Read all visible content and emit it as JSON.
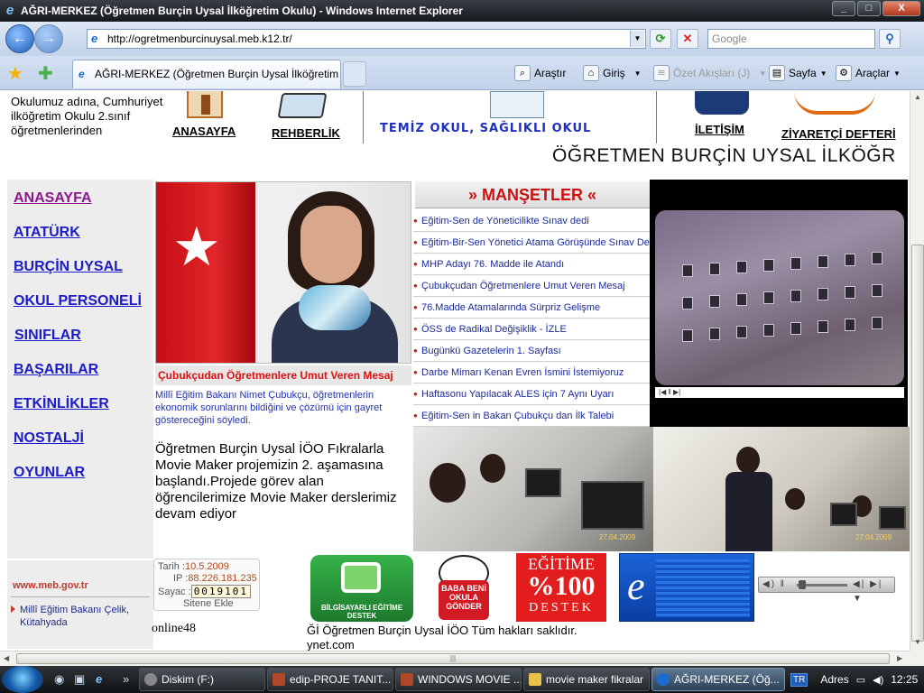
{
  "window": {
    "title": "AĞRI-MERKEZ (Öğretmen Burçin Uysal İlköğretim Okulu) - Windows Internet Explorer",
    "controls": [
      "_",
      "□",
      "X"
    ]
  },
  "navbar": {
    "url": "http://ogretmenburcinuysal.meb.k12.tr/",
    "search_placeholder": "Google"
  },
  "tabbar": {
    "tab_title": "AĞRI-MERKEZ (Öğretmen Burçin Uysal İlköğretim Okulu)",
    "commands": [
      {
        "label": "Araştır",
        "icon": "research-icon",
        "enabled": true
      },
      {
        "label": "Giriş",
        "icon": "home-icon",
        "enabled": true
      },
      {
        "label": "Özet Akışları (J)",
        "icon": "feeds-icon",
        "enabled": false
      },
      {
        "label": "Sayfa",
        "icon": "page-icon",
        "enabled": true
      },
      {
        "label": "Araçlar",
        "icon": "tools-icon",
        "enabled": true
      }
    ]
  },
  "page": {
    "welcome_text": "Okulumuz adına, Cumhuriyet ilköğretim Okulu 2.sınıf öğretmenlerinden",
    "top_links": [
      "ANASAYFA",
      "REHBERLİK",
      "İLETİŞİM",
      "ZİYARETÇİ DEFTERİ"
    ],
    "banner_text": "TEMİZ OKUL, SAĞLIKLI OKUL",
    "marquee": "ÖĞRETMEN BURÇİN UYSAL İLKÖĞR",
    "sidebar": [
      "ANASAYFA",
      "ATATÜRK",
      "BURÇİN UYSAL",
      "OKUL PERSONELİ",
      "SINIFLAR",
      "BAŞARILAR",
      "ETKİNLİKLER",
      "NOSTALJİ",
      "OYUNLAR"
    ],
    "meb": {
      "title": "www.meb.gov.tr",
      "item": "Millî Eğitim Bakanı Çelik, Kütahyada"
    },
    "feature": {
      "caption": "Çubukçudan Öğretmenlere Umut Veren Mesaj",
      "description": "Millî Eğitim Bakanı Nimet Çubukçu, öğretmenlerin ekonomik sorunlarını bildiğini ve çözümü için gayret göstereceğini söyledi."
    },
    "news_text": "Öğretmen Burçin Uysal İÖO Fıkralarla Movie Maker projemizin 2. aşamasına başlandı.Projede görev alan öğrencilerimize Movie Maker  derslerimiz devam ediyor",
    "manset": {
      "title": "» MANŞETLER «",
      "items": [
        "Eğitim-Sen de Yöneticilikte Sınav dedi",
        "Eğitim-Bir-Sen Yönetici Atama Görüşünde Sınav Dedi",
        "MHP Adayı 76. Madde ile Atandı",
        "Çubukçudan Öğretmenlere Umut Veren Mesaj",
        "76.Madde Atamalarında Sürpriz Gelişme",
        "ÖSS de Radikal Değişiklik - İZLE",
        "Bugünkü Gazetelerin 1. Sayfası",
        "Darbe Mimarı Kenan Evren İsmini İstemiyoruz",
        "Haftasonu Yapılacak ALES için 7 Aynı Uyarı",
        "Eğitim-Sen in Bakan Çubukçu dan İlk Talebi"
      ]
    },
    "photo_dates": [
      "27.04.2009",
      "27.04.2009"
    ],
    "counter": {
      "date_label": "Tarih :",
      "date": "10.5.2009",
      "ip_label": "IP :",
      "ip": "88.226.181.235",
      "count_label": "Sayac :",
      "count": "0019101",
      "add_label": "Sitene Ekle"
    },
    "logos": {
      "logo1_text": "BİLGİSAYARLI EĞİTİME DESTEK",
      "logo2_text": "BABA BENİ OKULA GÖNDER",
      "logo3_top": "EĞİTİME",
      "logo3_mid": "%100",
      "logo3_bot": "DESTEK"
    },
    "online": "online48",
    "copyright": "Ğİ Öğretmen Burçin Uysal İÖO Tüm hakları saklıdır.",
    "copyright2": "ynet.com"
  },
  "taskbar": {
    "items": [
      {
        "label": "Diskim (F:)",
        "active": false
      },
      {
        "label": "edip-PROJE TANIT...",
        "active": false
      },
      {
        "label": "WINDOWS MOVIE ...",
        "active": false
      },
      {
        "label": "movie maker fikralar",
        "active": false
      },
      {
        "label": "AĞRI-MERKEZ (Öğ...",
        "active": true
      }
    ],
    "lang": "TR",
    "address_label": "Adres",
    "clock": "12:25"
  }
}
